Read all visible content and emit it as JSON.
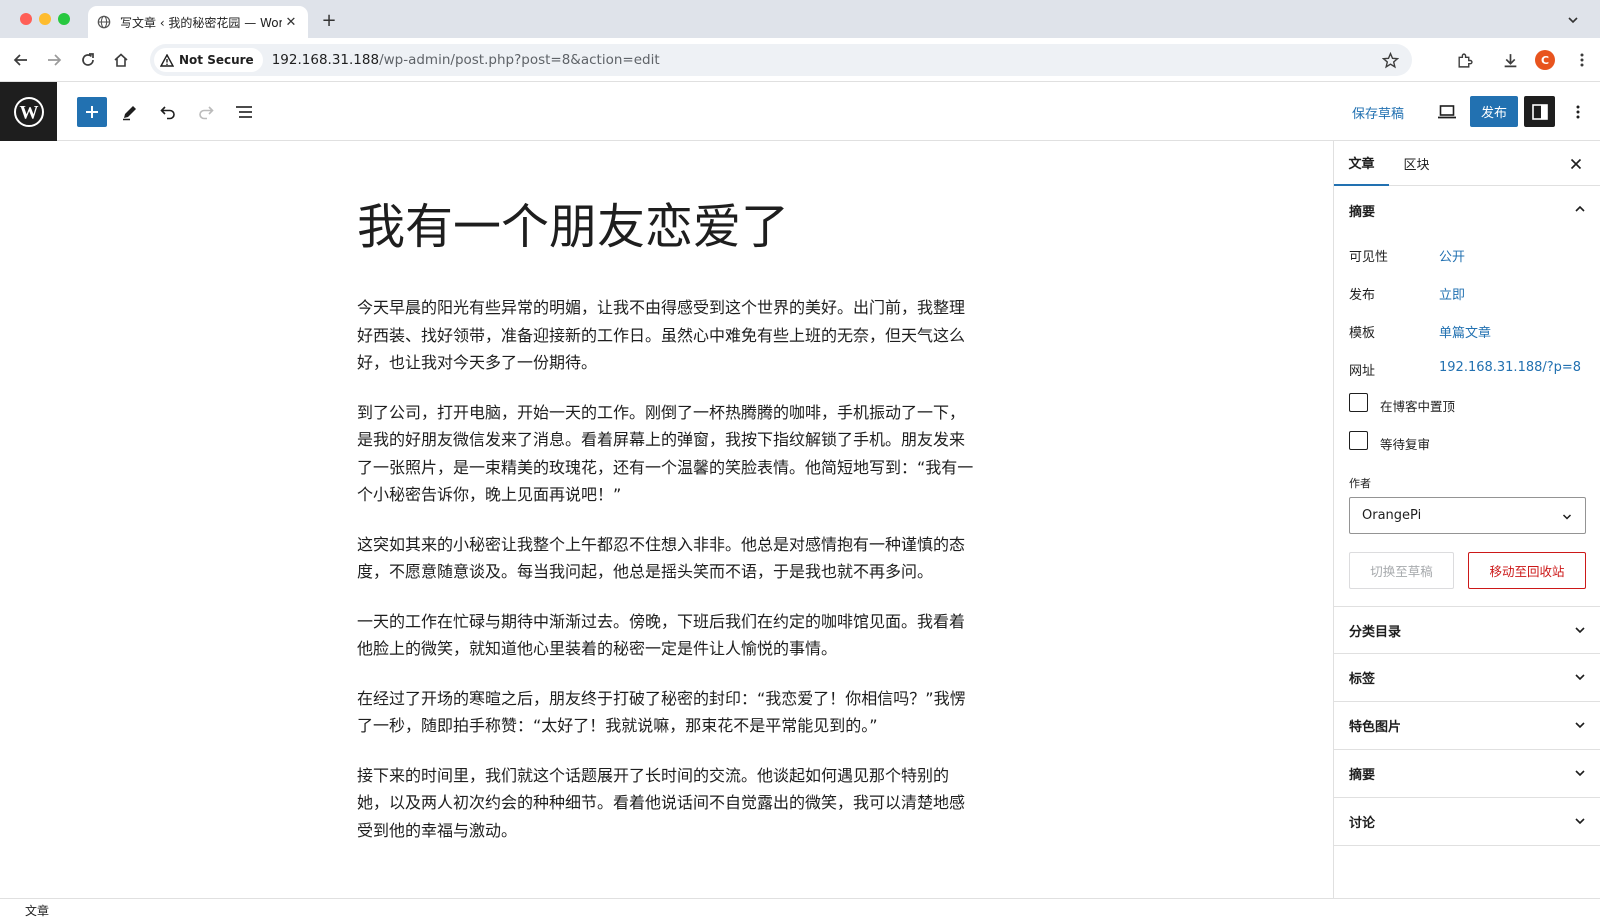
{
  "browser": {
    "tab_title": "写文章 ‹ 我的秘密花园 — Word",
    "security_label": "Not Secure",
    "url_host": "192.168.31.188",
    "url_path": "/wp-admin/post.php?post=8&action=edit",
    "profile_initial": "C"
  },
  "header": {
    "save_draft": "保存草稿",
    "publish": "发布"
  },
  "post": {
    "title": "我有一个朋友恋爱了",
    "paragraphs": [
      "今天早晨的阳光有些异常的明媚，让我不由得感受到这个世界的美好。出门前，我整理好西装、找好领带，准备迎接新的工作日。虽然心中难免有些上班的无奈，但天气这么好，也让我对今天多了一份期待。",
      "到了公司，打开电脑，开始一天的工作。刚倒了一杯热腾腾的咖啡，手机振动了一下，是我的好朋友微信发来了消息。看着屏幕上的弹窗，我按下指纹解锁了手机。朋友发来了一张照片，是一束精美的玫瑰花，还有一个温馨的笑脸表情。他简短地写到：“我有一个小秘密告诉你，晚上见面再说吧！”",
      "这突如其来的小秘密让我整个上午都忍不住想入非非。他总是对感情抱有一种谨慎的态度，不愿意随意谈及。每当我问起，他总是摇头笑而不语，于是我也就不再多问。",
      "一天的工作在忙碌与期待中渐渐过去。傍晚，下班后我们在约定的咖啡馆见面。我看着他脸上的微笑，就知道他心里装着的秘密一定是件让人愉悦的事情。",
      "在经过了开场的寒暄之后，朋友终于打破了秘密的封印：“我恋爱了！你相信吗？”我愣了一秒，随即拍手称赞：“太好了！我就说嘛，那束花不是平常能见到的。”",
      "接下来的时间里，我们就这个话题展开了长时间的交流。他谈起如何遇见那个特别的她，以及两人初次约会的种种细节。看着他说话间不自觉露出的微笑，我可以清楚地感受到他的幸福与激动。"
    ]
  },
  "sidebar": {
    "tab_post": "文章",
    "tab_block": "区块",
    "summary_title": "摘要",
    "visibility_label": "可见性",
    "visibility_value": "公开",
    "publish_label": "发布",
    "publish_value": "立即",
    "template_label": "模板",
    "template_value": "单篇文章",
    "url_label": "网址",
    "url_value": "192.168.31.188/?p=8",
    "sticky_label": "在博客中置顶",
    "pending_label": "等待复审",
    "author_label": "作者",
    "author_value": "OrangePi",
    "switch_draft": "切换至草稿",
    "move_trash": "移动至回收站",
    "panels": [
      "分类目录",
      "标签",
      "特色图片",
      "摘要",
      "讨论"
    ]
  },
  "footer": {
    "breadcrumb": "文章"
  }
}
